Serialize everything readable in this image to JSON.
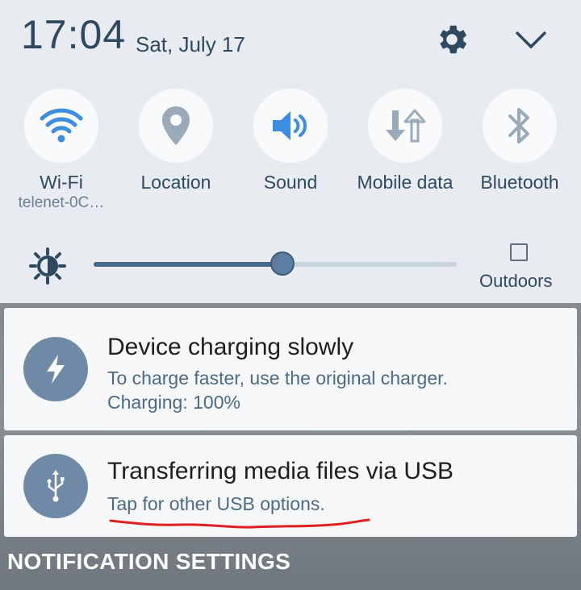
{
  "status": {
    "time": "17:04",
    "date": "Sat, July 17"
  },
  "header": {
    "settings_icon": "gear-icon",
    "collapse_icon": "chevron-down-icon"
  },
  "quick_settings": [
    {
      "label": "Wi-Fi",
      "sub": "telenet-0C…",
      "icon": "wifi-icon",
      "active": true
    },
    {
      "label": "Location",
      "sub": "",
      "icon": "location-pin-icon",
      "active": false
    },
    {
      "label": "Sound",
      "sub": "",
      "icon": "speaker-icon",
      "active": true
    },
    {
      "label": "Mobile data",
      "sub": "",
      "icon": "data-arrows-icon",
      "active": false
    },
    {
      "label": "Bluetooth",
      "sub": "",
      "icon": "bluetooth-icon",
      "active": false
    }
  ],
  "brightness": {
    "level_percent": 52,
    "outdoors_label": "Outdoors",
    "outdoors_checked": false
  },
  "notifications": [
    {
      "title": "Device charging slowly",
      "lines": [
        "To charge faster, use the original charger.",
        "Charging: 100%"
      ],
      "icon": "lightning-icon"
    },
    {
      "title": "Transferring media files via USB",
      "lines": [
        "Tap for other USB options."
      ],
      "icon": "usb-icon"
    }
  ],
  "footer": {
    "notification_settings": "NOTIFICATION SETTINGS"
  },
  "colors": {
    "accent": "#3d8ee0",
    "panel_bg": "#e8ecf0",
    "text_primary": "#2f4a60",
    "annotation": "#e02020"
  }
}
